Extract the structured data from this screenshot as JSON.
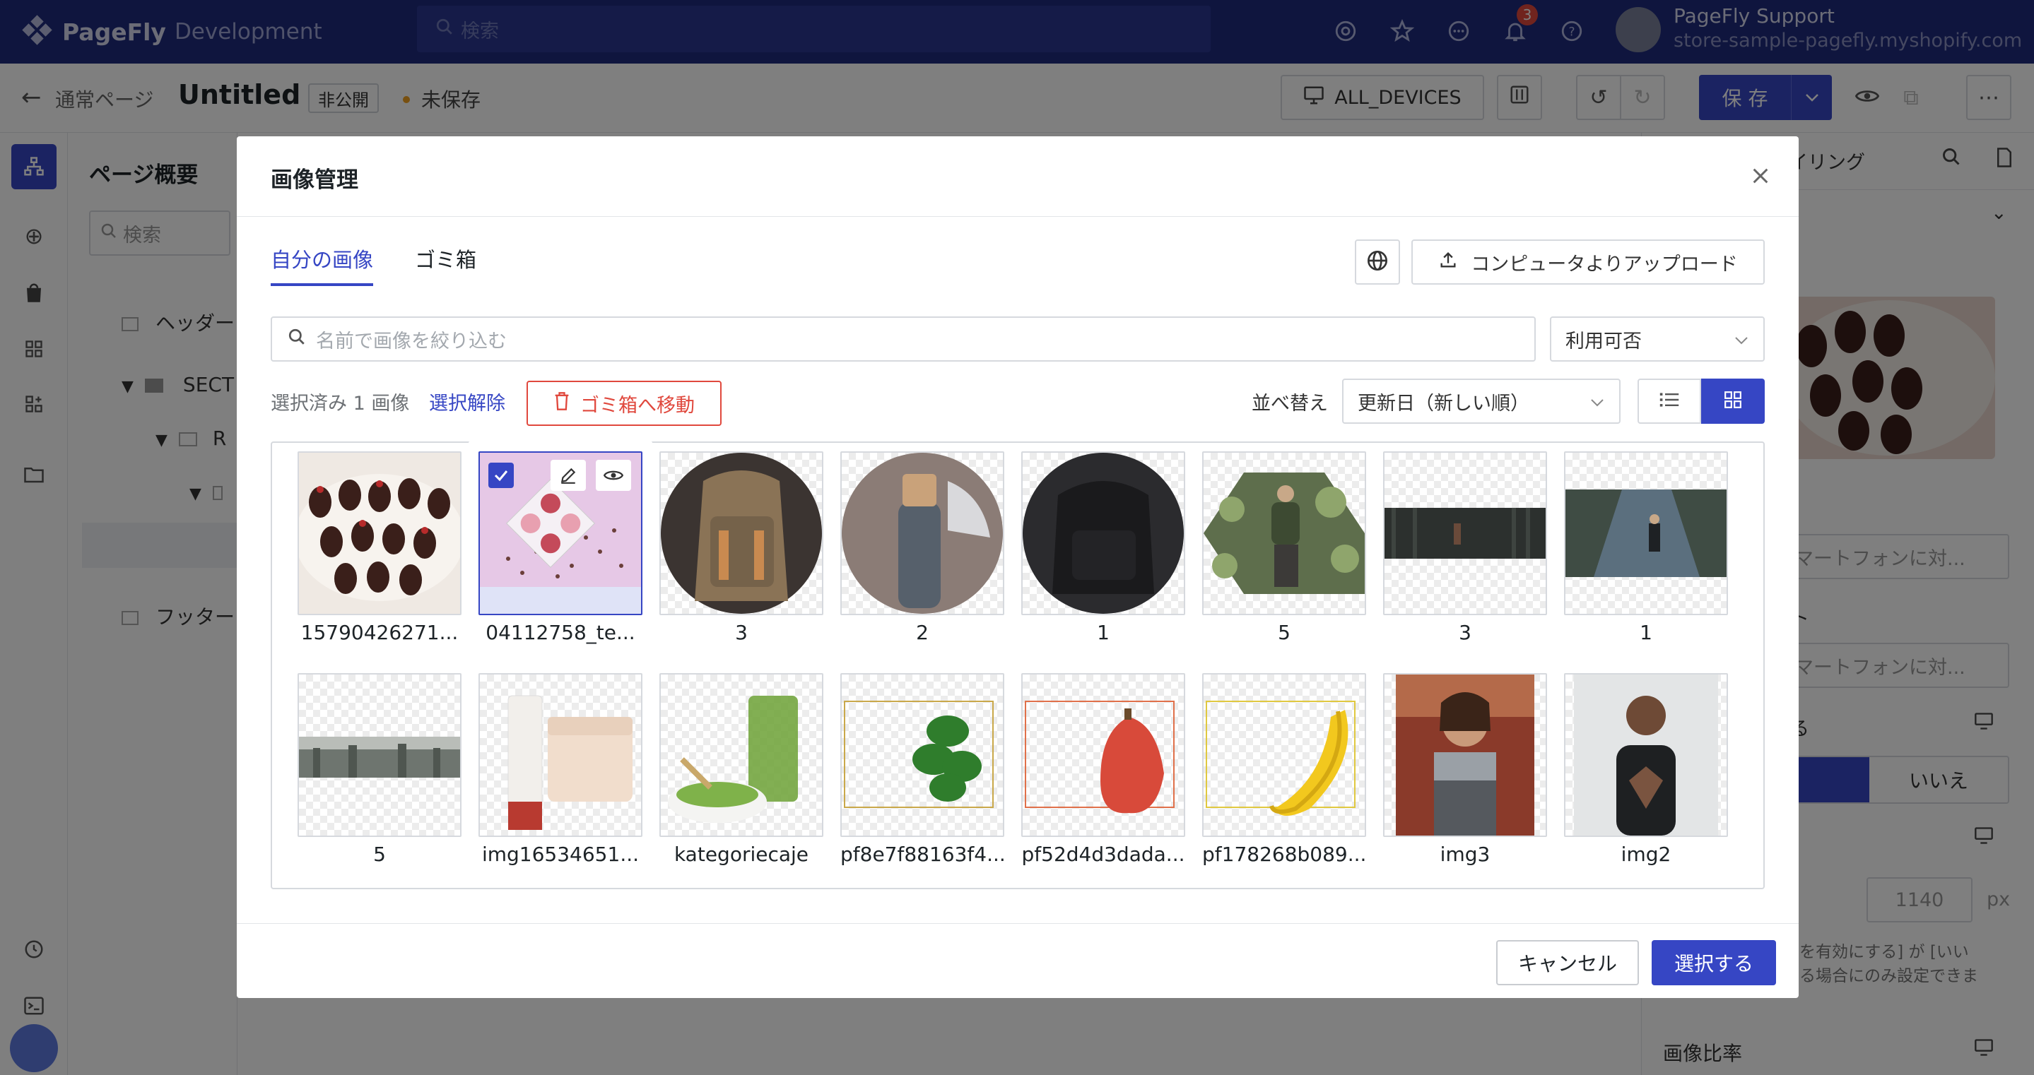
{
  "topbar": {
    "brand_name": "PageFly",
    "brand_env": "Development",
    "search_placeholder": "検索",
    "notification_count": "3",
    "user_name": "PageFly Support",
    "user_store": "store-sample-pagefly.myshopify.com"
  },
  "editor": {
    "page_type": "通常ページ",
    "page_title": "Untitled",
    "status_badge": "非公開",
    "unsaved": "未保存",
    "device": "ALL_DEVICES",
    "save": "保 存"
  },
  "left_panel": {
    "title": "ページ概要",
    "search_placeholder": "検索",
    "rows": [
      "ヘッダー",
      "SECT",
      "R",
      "フッター"
    ]
  },
  "right_panel": {
    "tab_partial": "イリング",
    "input_placeholder_1": "マートフォンに対...",
    "label_1": "ト",
    "input_placeholder_2": "マートフォンに対...",
    "label_2": "る",
    "seg_no": "いいえ",
    "width_value": "1140",
    "width_unit": "px",
    "note_line1": "幅を有効にする] が [いい",
    "note_line2": "いる場合にのみ設定できま",
    "aspect_label": "画像比率"
  },
  "modal": {
    "title": "画像管理",
    "tabs": [
      "自分の画像",
      "ゴミ箱"
    ],
    "upload_label": "コンピュータよりアップロード",
    "filter_placeholder": "名前で画像を絞り込む",
    "availability_label": "利用可否",
    "selected_count": "選択済み 1 画像",
    "clear_selection": "選択解除",
    "move_to_trash": "ゴミ箱へ移動",
    "sort_label": "並べ替え",
    "sort_value": "更新日（新しい順）",
    "cancel": "キャンセル",
    "choose": "選択する",
    "images": [
      {
        "name": "15790426271..."
      },
      {
        "name": "04112758_te..."
      },
      {
        "name": "3"
      },
      {
        "name": "2"
      },
      {
        "name": "1"
      },
      {
        "name": "5"
      },
      {
        "name": "3"
      },
      {
        "name": "1"
      },
      {
        "name": "5"
      },
      {
        "name": "img16534651..."
      },
      {
        "name": "kategoriecaje"
      },
      {
        "name": "pf8e7f88163f4..."
      },
      {
        "name": "pf52d4d3dada..."
      },
      {
        "name": "pf178268b089..."
      },
      {
        "name": "img3"
      },
      {
        "name": "img2"
      }
    ]
  },
  "colors": {
    "primary": "#3646c4",
    "topbar": "#1e2a7c",
    "danger": "#e0483d"
  }
}
